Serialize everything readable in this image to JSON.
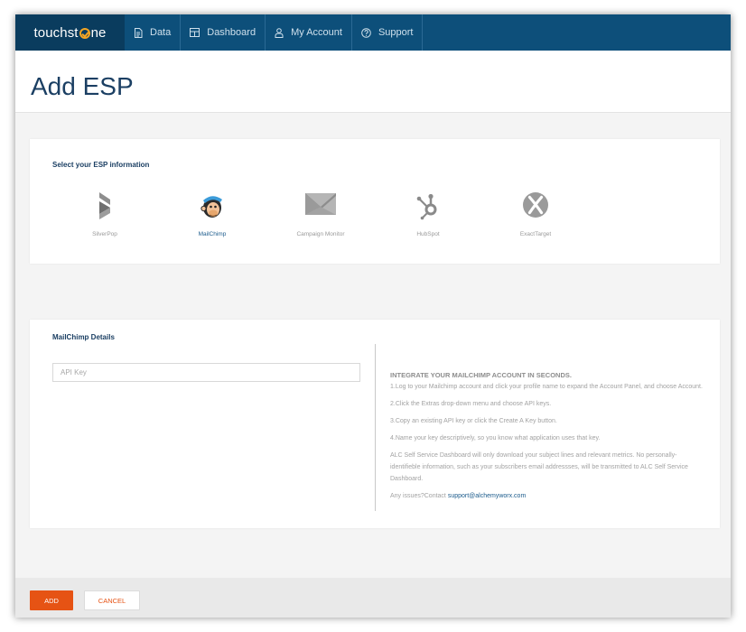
{
  "brand": {
    "name_pre": "touchst",
    "name_post": "ne"
  },
  "nav": [
    {
      "label": "Data",
      "icon": "document-icon"
    },
    {
      "label": "Dashboard",
      "icon": "dashboard-icon"
    },
    {
      "label": "My Account",
      "icon": "user-icon"
    },
    {
      "label": "Support",
      "icon": "help-icon"
    }
  ],
  "page": {
    "title": "Add ESP"
  },
  "esp_section": {
    "title": "Select your ESP information",
    "options": [
      {
        "label": "SilverPop",
        "icon": "silverpop-icon",
        "selected": false
      },
      {
        "label": "MailChimp",
        "icon": "mailchimp-icon",
        "selected": true
      },
      {
        "label": "Campaign Monitor",
        "icon": "campaign-monitor-icon",
        "selected": false
      },
      {
        "label": "HubSpot",
        "icon": "hubspot-icon",
        "selected": false
      },
      {
        "label": "ExactTarget",
        "icon": "exacttarget-icon",
        "selected": false
      }
    ]
  },
  "details": {
    "title": "MailChimp Details",
    "api_key": {
      "placeholder": "API Key",
      "value": ""
    },
    "info": {
      "heading": "INTEGRATE YOUR MAILCHIMP ACCOUNT IN SECONDS.",
      "step1": "1.Log to your Mailchimp account and click your profile name to expand the Account Panel, and choose Account.",
      "step2": "2.Click the Extras drop-down menu and choose API keys.",
      "step3": "3.Copy an existing API key or click the Create A Key button.",
      "step4": "4.Name your key descriptively, so you know what application uses that key.",
      "privacy": "ALC Self Service Dashboard will only download your subject lines and relevant metrics. No personally-identifieble information, such as your subscribers email addressses, will be transmitted to ALC Self Service Dashboard.",
      "issues_prefix": "Any issues?Contact ",
      "support_email": "support@alchemyworx.com"
    }
  },
  "footer": {
    "add_label": "ADD",
    "cancel_label": "CANCEL"
  },
  "colors": {
    "nav_bg": "#0d4f7a",
    "brand_bg": "#0a3c5e",
    "accent": "#e65314",
    "title": "#1b3f63",
    "link": "#1b5b8c"
  }
}
